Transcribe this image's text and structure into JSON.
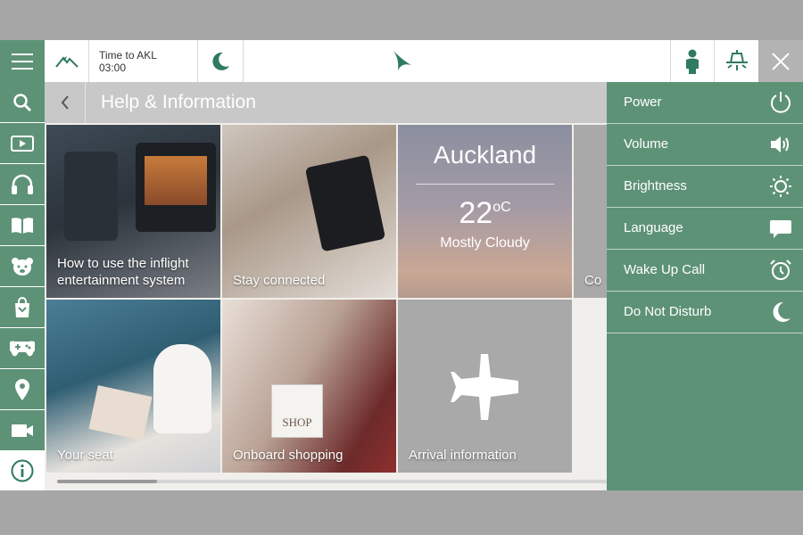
{
  "topbar": {
    "time_label": "Time to AKL",
    "time_value": "03:00",
    "icons": [
      "menu-icon",
      "flight-path-icon",
      "moon-icon",
      "brushwing-logo-icon",
      "attendant-icon",
      "reading-light-icon",
      "close-icon"
    ]
  },
  "leftnav": {
    "items": [
      "search-icon",
      "play-icon",
      "headphones-icon",
      "book-icon",
      "teddy-bear-icon",
      "shopping-bag-icon",
      "gamepad-icon",
      "location-pin-icon",
      "video-camera-icon",
      "info-icon"
    ],
    "active": "info-icon"
  },
  "header": {
    "title": "Help & Information"
  },
  "tiles": {
    "t1": "How to use the inflight entertainment system",
    "t2": "Stay connected",
    "weather_city": "Auckland",
    "weather_temp": "22",
    "weather_unit": "oC",
    "weather_desc": "Mostly Cloudy",
    "t4_partial": "Co",
    "t5": "Your seat",
    "t6": "Onboard shopping",
    "shop_text": "SHOP",
    "t7": "Arrival information"
  },
  "rightpanel": {
    "items": [
      "Power",
      "Volume",
      "Brightness",
      "Language",
      "Wake Up Call",
      "Do Not Disturb"
    ]
  },
  "colors": {
    "accent": "#5e9277",
    "header": "#c8c8c8",
    "tile_gray": "#a9a9a9"
  }
}
